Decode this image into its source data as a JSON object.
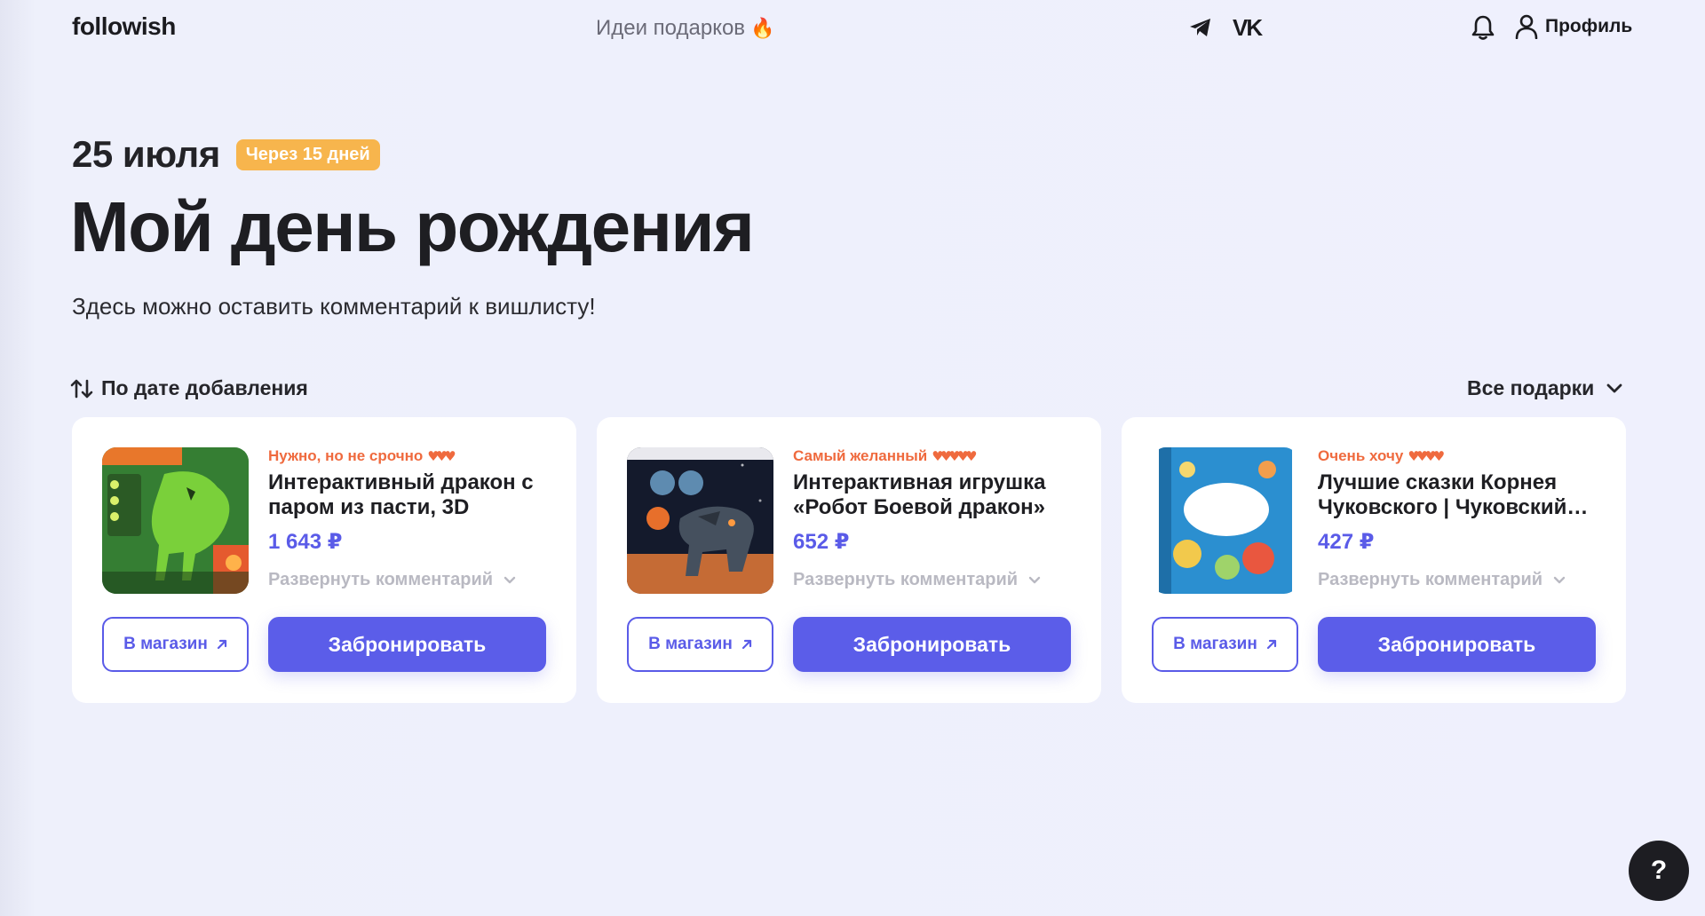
{
  "header": {
    "logo": "followish",
    "ideas_link": "Идеи подарков",
    "ideas_icon": "fire-icon",
    "social": [
      "telegram-icon",
      "vk-icon"
    ],
    "vk_label": "VK",
    "notifications_icon": "bell-icon",
    "profile_label": "Профиль"
  },
  "event": {
    "date": "25 июля",
    "countdown": "Через 15 дней",
    "title": "Мой день рождения",
    "description": "Здесь можно оставить комментарий к вишлисту!"
  },
  "controls": {
    "sort_label": "По дате добавления",
    "filter_label": "Все подарки"
  },
  "items": [
    {
      "priority": "Нужно, но не срочно",
      "hearts": "♥♥♥",
      "title": "Интерактивный дракон с паром из пасти, 3D",
      "price": "1 643 ₽",
      "expand": "Развернуть комментарий",
      "shop": "В магазин",
      "reserve": "Забронировать"
    },
    {
      "priority": "Самый желанный",
      "hearts": "♥♥♥♥♥",
      "title": "Интерактивная игрушка «Робот Боевой дракон»",
      "price": "652 ₽",
      "expand": "Развернуть комментарий",
      "shop": "В магазин",
      "reserve": "Забронировать"
    },
    {
      "priority": "Очень хочу",
      "hearts": "♥♥♥♥",
      "title": "Лучшие сказки Корнея Чуковского | Чуковский…",
      "price": "427 ₽",
      "expand": "Развернуть комментарий",
      "shop": "В магазин",
      "reserve": "Забронировать"
    }
  ],
  "help_label": "?",
  "colors": {
    "accent": "#5b5de9",
    "priority": "#ef6a3e",
    "badge": "#f7b54d",
    "background": "#eff0fd"
  }
}
